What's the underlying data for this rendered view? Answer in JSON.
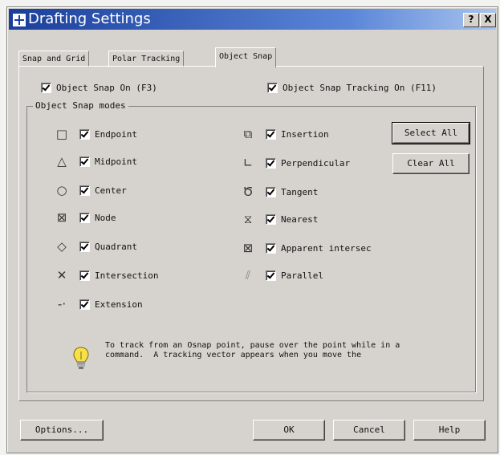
{
  "window": {
    "title": "Drafting Settings",
    "help_button": "?",
    "close_button": "X"
  },
  "tabs": [
    {
      "label": "Snap and Grid",
      "active": false
    },
    {
      "label": "Polar Tracking",
      "active": false
    },
    {
      "label": "Object Snap",
      "active": true
    }
  ],
  "top_options": {
    "object_snap_on": {
      "label": "Object Snap On (F3)",
      "checked": true
    },
    "object_snap_tracking_on": {
      "label": "Object Snap Tracking On (F11)",
      "checked": true
    }
  },
  "modes_group": {
    "label": "Object Snap modes",
    "left": [
      {
        "label": "Endpoint",
        "checked": true,
        "icon": "square-icon"
      },
      {
        "label": "Midpoint",
        "checked": true,
        "icon": "triangle-icon"
      },
      {
        "label": "Center",
        "checked": true,
        "icon": "circle-icon"
      },
      {
        "label": "Node",
        "checked": true,
        "icon": "node-icon"
      },
      {
        "label": "Quadrant",
        "checked": true,
        "icon": "diamond-icon"
      },
      {
        "label": "Intersection",
        "checked": true,
        "icon": "x-icon"
      },
      {
        "label": "Extension",
        "checked": true,
        "icon": "extension-icon"
      }
    ],
    "right": [
      {
        "label": "Insertion",
        "checked": true,
        "icon": "insertion-icon"
      },
      {
        "label": "Perpendicular",
        "checked": true,
        "icon": "perpendicular-icon"
      },
      {
        "label": "Tangent",
        "checked": true,
        "icon": "tangent-icon"
      },
      {
        "label": "Nearest",
        "checked": true,
        "icon": "nearest-icon"
      },
      {
        "label": "Apparent intersec",
        "checked": true,
        "icon": "apparent-intersection-icon"
      },
      {
        "label": "Parallel",
        "checked": true,
        "icon": "parallel-icon"
      }
    ],
    "select_all": "Select All",
    "clear_all": "Clear All"
  },
  "hint": {
    "icon": "lightbulb-icon",
    "text": "To track from an Osnap point, pause over the point while in a\ncommand.  A tracking vector appears when you move the"
  },
  "footer": {
    "options": "Options...",
    "ok": "OK",
    "cancel": "Cancel",
    "help": "Help"
  }
}
